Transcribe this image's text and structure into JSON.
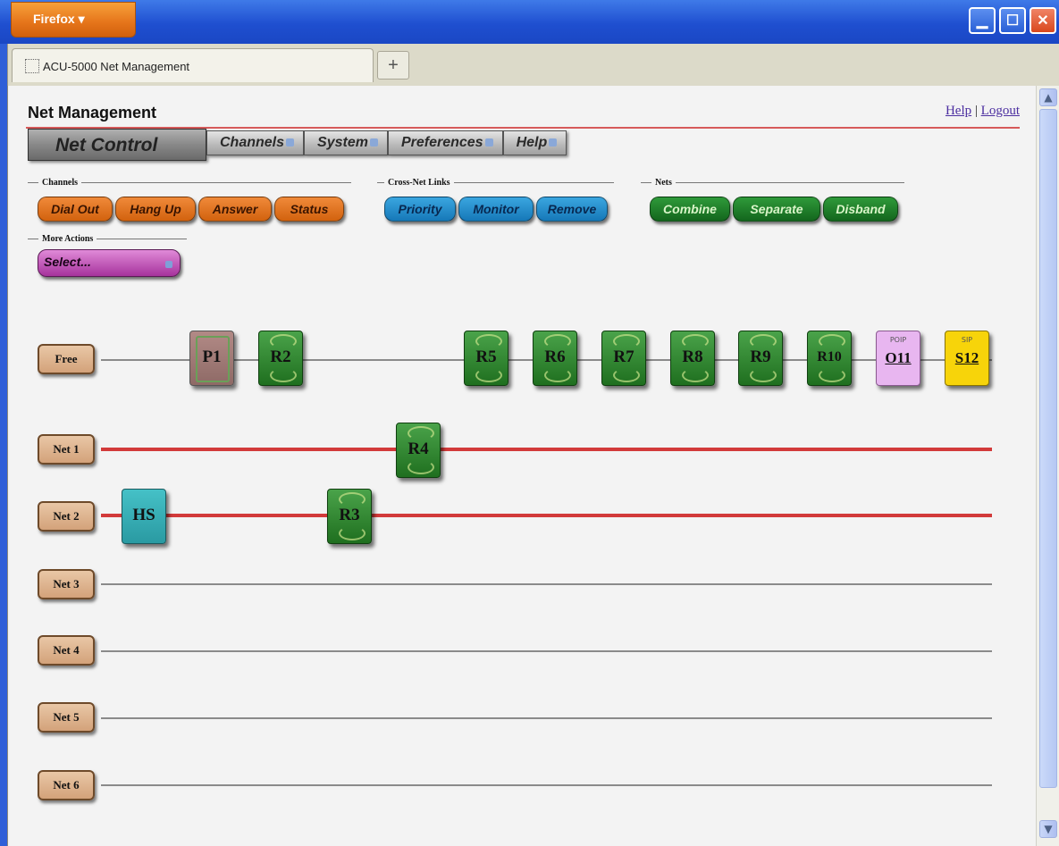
{
  "browser": {
    "menu_label": "Firefox",
    "tab_title": "ACU-5000 Net Management",
    "new_tab_label": "+"
  },
  "page": {
    "title": "Net Management",
    "help_link": "Help",
    "separator": "|",
    "logout_link": "Logout"
  },
  "menu": {
    "active": "Net Control",
    "items": [
      "Channels",
      "System",
      "Preferences",
      "Help"
    ]
  },
  "groups": {
    "channels": {
      "label": "Channels",
      "buttons": [
        "Dial Out",
        "Hang Up",
        "Answer",
        "Status"
      ]
    },
    "cross_net": {
      "label": "Cross-Net Links",
      "buttons": [
        "Priority",
        "Monitor",
        "Remove"
      ]
    },
    "nets": {
      "label": "Nets",
      "buttons": [
        "Combine",
        "Separate",
        "Disband"
      ]
    },
    "more_actions": {
      "label": "More Actions",
      "select_value": "Select..."
    }
  },
  "rows": [
    {
      "label": "Free",
      "color": "#8a8a8a"
    },
    {
      "label": "Net 1",
      "color": "#d23a3a"
    },
    {
      "label": "Net 2",
      "color": "#d23a3a"
    },
    {
      "label": "Net 3",
      "color": "#8a8a8a"
    },
    {
      "label": "Net 4",
      "color": "#8a8a8a"
    },
    {
      "label": "Net 5",
      "color": "#8a8a8a"
    },
    {
      "label": "Net 6",
      "color": "#8a8a8a"
    }
  ],
  "nodes": {
    "p1": {
      "label": "P1",
      "type": "phone"
    },
    "r2": {
      "label": "R2",
      "type": "radio"
    },
    "r5": {
      "label": "R5",
      "type": "radio"
    },
    "r6": {
      "label": "R6",
      "type": "radio"
    },
    "r7": {
      "label": "R7",
      "type": "radio"
    },
    "r8": {
      "label": "R8",
      "type": "radio"
    },
    "r9": {
      "label": "R9",
      "type": "radio"
    },
    "r10": {
      "label": "R10",
      "type": "radio"
    },
    "o11": {
      "label": "O11",
      "tag": "POIP",
      "type": "poip"
    },
    "s12": {
      "label": "S12",
      "tag": "SIP",
      "type": "sip"
    },
    "r4": {
      "label": "R4",
      "type": "radio"
    },
    "hs": {
      "label": "HS",
      "type": "handset"
    },
    "r3": {
      "label": "R3",
      "type": "radio"
    }
  }
}
